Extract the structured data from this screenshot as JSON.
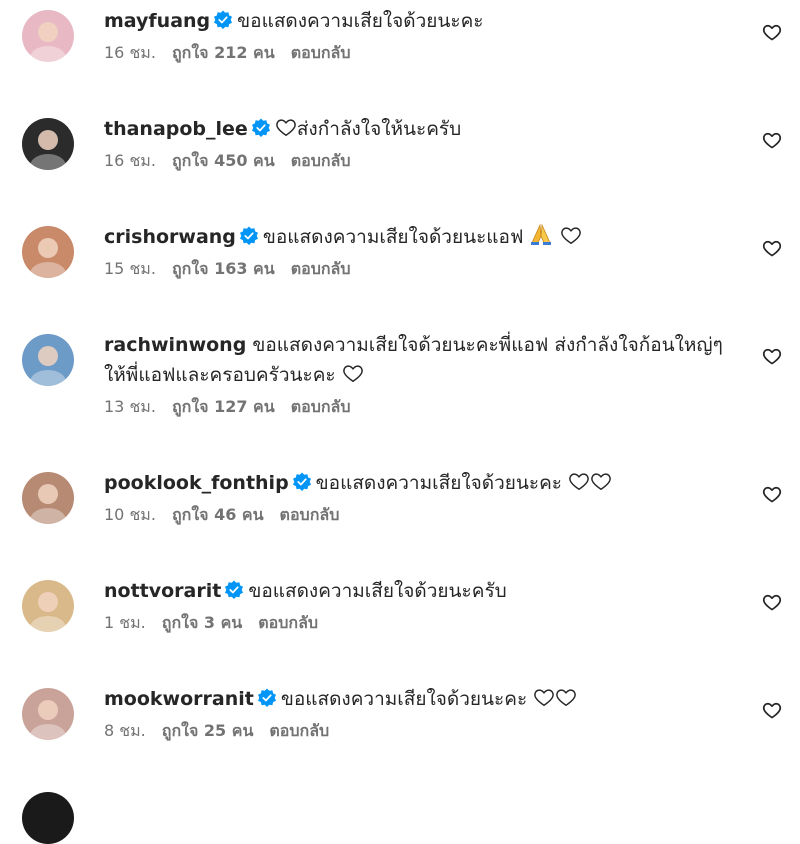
{
  "comments": [
    {
      "username": "mayfuang",
      "verified": true,
      "text": "ขอแสดงความเสียใจด้วยนะคะ",
      "trailing": [],
      "time": "16 ชม.",
      "likes": "ถูกใจ 212 คน",
      "reply": "ตอบกลับ",
      "avatar_color": "#e8b9c4"
    },
    {
      "username": "thanapob_lee",
      "verified": true,
      "text": "ส่งกำลังใจให้นะครับ",
      "leading": [
        "heart"
      ],
      "trailing": [],
      "time": "16 ชม.",
      "likes": "ถูกใจ 450 คน",
      "reply": "ตอบกลับ",
      "avatar_color": "#2b2b2b"
    },
    {
      "username": "crishorwang",
      "verified": true,
      "text": "ขอแสดงความเสียใจด้วยนะแอฟ",
      "trailing": [
        "pray",
        "heart"
      ],
      "time": "15 ชม.",
      "likes": "ถูกใจ 163 คน",
      "reply": "ตอบกลับ",
      "avatar_color": "#c98a6a"
    },
    {
      "username": "rachwinwong",
      "verified": false,
      "text": "ขอแสดงความเสียใจด้วยนะคะพี่แอฟ ส่งกำลังใจก้อนใหญ่ๆให้พี่แอฟและครอบครัวนะคะ",
      "trailing": [
        "heart"
      ],
      "time": "13 ชม.",
      "likes": "ถูกใจ 127 คน",
      "reply": "ตอบกลับ",
      "avatar_color": "#6d9bc7"
    },
    {
      "username": "pooklook_fonthip",
      "verified": true,
      "text": "ขอแสดงความเสียใจด้วยนะคะ",
      "trailing": [
        "heart",
        "heart"
      ],
      "time": "10 ชม.",
      "likes": "ถูกใจ 46 คน",
      "reply": "ตอบกลับ",
      "avatar_color": "#b68a73"
    },
    {
      "username": "nottvorarit",
      "verified": true,
      "text": "ขอแสดงความเสียใจด้วยนะครับ",
      "trailing": [],
      "time": "1 ชม.",
      "likes": "ถูกใจ 3 คน",
      "reply": "ตอบกลับ",
      "avatar_color": "#d9b98a"
    },
    {
      "username": "mookworranit",
      "verified": true,
      "text": "ขอแสดงความเสียใจด้วยนะคะ",
      "trailing": [
        "heart",
        "heart"
      ],
      "time": "8 ชม.",
      "likes": "ถูกใจ 25 คน",
      "reply": "ตอบกลับ",
      "avatar_color": "#c9a39a"
    }
  ],
  "colors": {
    "text": "#262626",
    "meta": "#737373",
    "verified": "#0095f6"
  },
  "icons": {
    "like": "heart-outline-icon",
    "verified": "verified-badge-icon"
  }
}
